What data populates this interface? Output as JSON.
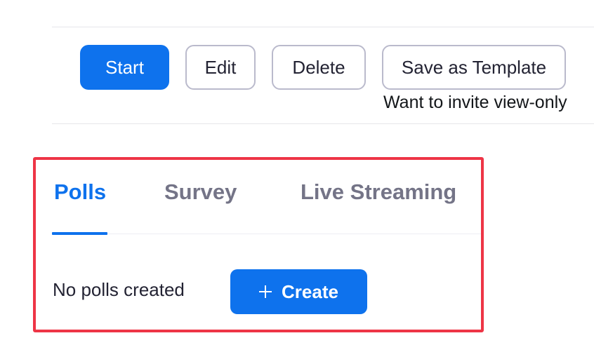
{
  "actions": {
    "start_label": "Start",
    "edit_label": "Edit",
    "delete_label": "Delete",
    "save_template_label": "Save as Template",
    "view_only_note": "Want to invite view-only"
  },
  "tabs": [
    {
      "label": "Polls",
      "active": true
    },
    {
      "label": "Survey",
      "active": false
    },
    {
      "label": "Live Streaming",
      "active": false
    }
  ],
  "polls": {
    "empty_message": "No polls created",
    "create_label": "Create",
    "create_icon": "plus-icon"
  },
  "colors": {
    "primary": "#0e72ed",
    "highlight_border": "#ee3546",
    "inactive_tab": "#747487",
    "outline_border": "#babacc"
  }
}
